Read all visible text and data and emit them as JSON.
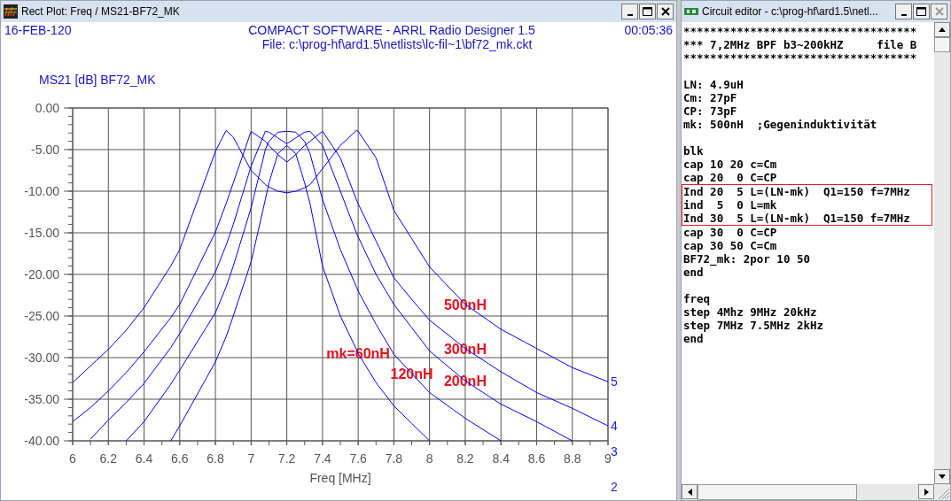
{
  "plot_window": {
    "title": "Rect Plot: Freq / MS21-BF72_MK",
    "date": "16-FEB-120",
    "heading": "COMPACT SOFTWARE - ARRL Radio Designer 1.5",
    "file": "File: c:\\prog-hf\\ard1.5\\netlists\\lc-fil~1\\bf72_mk.ckt",
    "time": "00:05:36",
    "chart_data": {
      "type": "line",
      "title": "MS21 [dB] BF72_MK",
      "xlabel": "Freq [MHz]",
      "x": [
        6,
        6.1,
        6.2,
        6.3,
        6.4,
        6.55,
        6.6,
        6.8,
        6.86,
        6.9,
        7.0,
        7.08,
        7.1,
        7.15,
        7.2,
        7.25,
        7.3,
        7.33,
        7.4,
        7.5,
        7.59,
        7.6,
        7.7,
        7.8,
        7.9,
        8.0,
        8.2,
        8.4,
        8.6,
        8.8,
        9.0
      ],
      "series": [
        {
          "color": "#0000ff",
          "values": [
            -33,
            -31,
            -29,
            -26.7,
            -24,
            -19,
            -17,
            -5.2,
            -2.7,
            -3.5,
            -7.5,
            -9.2,
            -9.5,
            -10,
            -10.2,
            -10,
            -9.6,
            -9.2,
            -7.3,
            -4.5,
            -2.7,
            -2.8,
            -6,
            -12.3,
            -15.7,
            -19.1,
            -23.6,
            -26.6,
            -28.9,
            -31.2,
            -32.9
          ]
        },
        {
          "color": "#0000ff",
          "values": [
            -37.7,
            -36,
            -34,
            -31.8,
            -29.3,
            -25.2,
            -23.6,
            -14.9,
            -11.5,
            -9,
            -2.8,
            -4,
            -4.5,
            -5.6,
            -6.5,
            -5.6,
            -4.5,
            -4,
            -2.8,
            -6,
            -11,
            -11.5,
            -16,
            -20.4,
            -23,
            -25.5,
            -28.9,
            -31.7,
            -34.2,
            -36.1,
            -38.2
          ]
        },
        {
          "color": "#0000ff",
          "values": [
            null,
            -39.8,
            -37.5,
            -35.4,
            -33.1,
            -28.8,
            -27.1,
            -19.7,
            -16.5,
            -14,
            -7,
            -2.8,
            -2.9,
            -3.6,
            -4.3,
            -3.6,
            -2.9,
            -2.8,
            -4.5,
            -10,
            -15,
            -15.5,
            -20,
            -23.6,
            -26.4,
            -29.2,
            -32.8,
            -35.6,
            -37.7,
            -40,
            null
          ]
        },
        {
          "color": "#0000ff",
          "values": [
            null,
            null,
            null,
            -40,
            -37.7,
            -33.2,
            -31.5,
            -24.6,
            -21.5,
            -19,
            -12,
            -5,
            -4,
            -2.9,
            -2.8,
            -2.9,
            -4,
            -5.5,
            -11,
            -17,
            -21.5,
            -22,
            -26,
            -29.6,
            -31.9,
            -34.2,
            -37.3,
            -40,
            null,
            null,
            null
          ]
        },
        {
          "color": "#0000ff",
          "values": [
            null,
            null,
            null,
            null,
            null,
            -40,
            -38.2,
            -30.5,
            -27.5,
            -25,
            -18.5,
            -11,
            -9,
            -5.5,
            -4.5,
            -5.5,
            -9,
            -11.5,
            -19,
            -25,
            -29,
            -29.5,
            -33,
            -35.8,
            -37.9,
            -40,
            null,
            null,
            null,
            null,
            null
          ]
        }
      ],
      "xlim": [
        6,
        9
      ],
      "ylim": [
        -40,
        0
      ],
      "grid": true,
      "xticks": [
        6,
        6.2,
        6.4,
        6.6,
        6.8,
        7,
        7.2,
        7.4,
        7.6,
        7.8,
        8,
        8.2,
        8.4,
        8.6,
        8.8,
        9
      ],
      "yticks": [
        {
          "value": 0,
          "label": "0.00"
        },
        {
          "value": -5,
          "label": "-5.00"
        },
        {
          "value": -10,
          "label": "-10.00"
        },
        {
          "value": -15,
          "label": "-15.00"
        },
        {
          "value": -20,
          "label": "-20.00"
        },
        {
          "value": -25,
          "label": "-25.00"
        },
        {
          "value": -30,
          "label": "-30.00"
        },
        {
          "value": -35,
          "label": "-35.00"
        },
        {
          "value": -40,
          "label": "-40.00"
        }
      ],
      "annotations": [
        {
          "text": "500nH",
          "x": 8.2,
          "y": -23.6
        },
        {
          "text": "300nH",
          "x": 8.2,
          "y": -28.9
        },
        {
          "text": "120nH",
          "x": 7.9,
          "y": -31.9
        },
        {
          "text": "200nH",
          "x": 8.2,
          "y": -32.8
        },
        {
          "text": "mk=60nH",
          "x": 7.6,
          "y": -29.5
        }
      ]
    },
    "trace_numbers": [
      "5",
      "4",
      "3",
      "2"
    ]
  },
  "editor_window": {
    "title": "Circuit editor - c:\\prog-hf\\ard1.5\\netl...",
    "lines": [
      {
        "kind": "text",
        "text": "***********************************",
        "highlighted": false
      },
      {
        "kind": "text",
        "text": "*** 7,2MHz BPF b3~200kHZ     file B",
        "highlighted": false
      },
      {
        "kind": "text",
        "text": "***********************************",
        "highlighted": false
      },
      {
        "kind": "blank"
      },
      {
        "kind": "text",
        "text": "LN: 4.9uH",
        "highlighted": false
      },
      {
        "kind": "text",
        "text": "Cm: 27pF",
        "highlighted": false
      },
      {
        "kind": "text",
        "text": "CP: 73pF",
        "highlighted": false
      },
      {
        "kind": "text",
        "text": "mk: 500nH  ;Gegeninduktivität",
        "highlighted": false
      },
      {
        "kind": "blank"
      },
      {
        "kind": "text",
        "text": "blk",
        "highlighted": false
      },
      {
        "kind": "text",
        "text": "cap 10 20 c=Cm",
        "highlighted": false
      },
      {
        "kind": "text",
        "text": "cap 20  0 C=CP",
        "highlighted": false
      },
      {
        "kind": "text",
        "text": "Ind 20  5 L=(LN-mk)  Q1=150 f=7MHz",
        "highlighted": true
      },
      {
        "kind": "text",
        "text": "ind  5  0 L=mk",
        "highlighted": true
      },
      {
        "kind": "text",
        "text": "Ind 30  5 L=(LN-mk)  Q1=150 f=7MHz",
        "highlighted": true
      },
      {
        "kind": "text",
        "text": "cap 30  0 C=CP",
        "highlighted": false
      },
      {
        "kind": "text",
        "text": "cap 30 50 C=Cm",
        "highlighted": false
      },
      {
        "kind": "text",
        "text": "BF72_mk: 2por 10 50",
        "highlighted": false
      },
      {
        "kind": "text",
        "text": "end",
        "highlighted": false
      },
      {
        "kind": "blank"
      },
      {
        "kind": "text",
        "text": "freq",
        "highlighted": false
      },
      {
        "kind": "text",
        "text": "step 4Mhz 9MHz 20kHz",
        "highlighted": false
      },
      {
        "kind": "text",
        "text": "step 7MHz 7.5MHz 2kHz",
        "highlighted": false
      },
      {
        "kind": "text",
        "text": "end",
        "highlighted": false
      }
    ]
  }
}
